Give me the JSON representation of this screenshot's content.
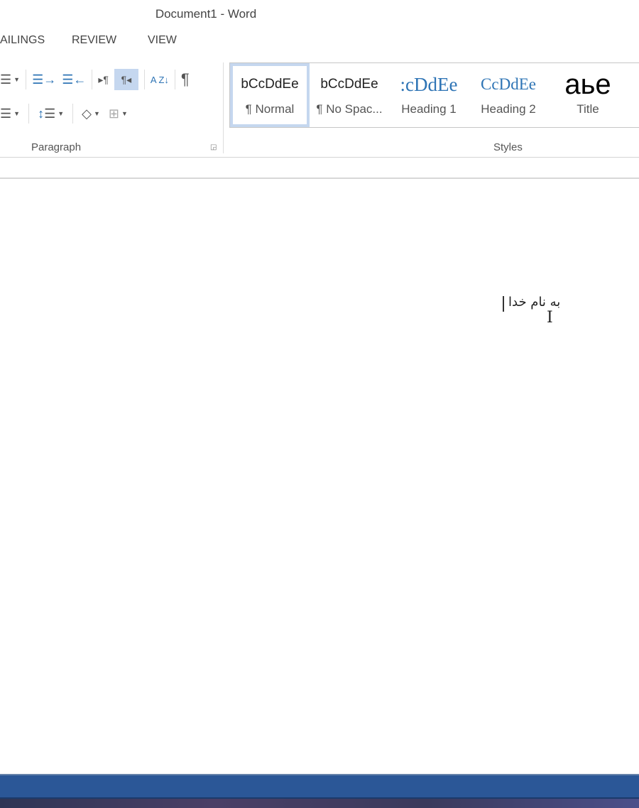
{
  "window": {
    "title": "Document1 - Word"
  },
  "tabs": [
    {
      "label": "AILINGS"
    },
    {
      "label": "REVIEW"
    },
    {
      "label": "VIEW"
    }
  ],
  "paragraph": {
    "group_label": "Paragraph",
    "icons": [
      "multilevel-list-icon",
      "decrease-indent-icon",
      "increase-indent-icon",
      "ltr-icon",
      "rtl-icon",
      "sort-icon",
      "show-formatting-icon",
      "justify-icon",
      "line-spacing-icon",
      "shading-icon",
      "borders-icon"
    ],
    "rtl_active": true,
    "pilcrow": "¶",
    "sort_glyph": "A Z↓"
  },
  "styles": {
    "group_label": "Styles",
    "items": [
      {
        "preview": "bCcDdEe",
        "label": "¶ Normal",
        "selected": true
      },
      {
        "preview": "bCcDdEe",
        "label": "¶ No Spac..."
      },
      {
        "preview": ":cDdEe",
        "label": "Heading 1"
      },
      {
        "preview": "CcDdEe",
        "label": "Heading 2"
      },
      {
        "preview": "aье",
        "label": "Title"
      }
    ]
  },
  "document": {
    "text": "به نام خدا"
  },
  "colors": {
    "accent": "#2b5797",
    "heading": "#2e74b5",
    "selected_style": "#c5d7ef"
  }
}
